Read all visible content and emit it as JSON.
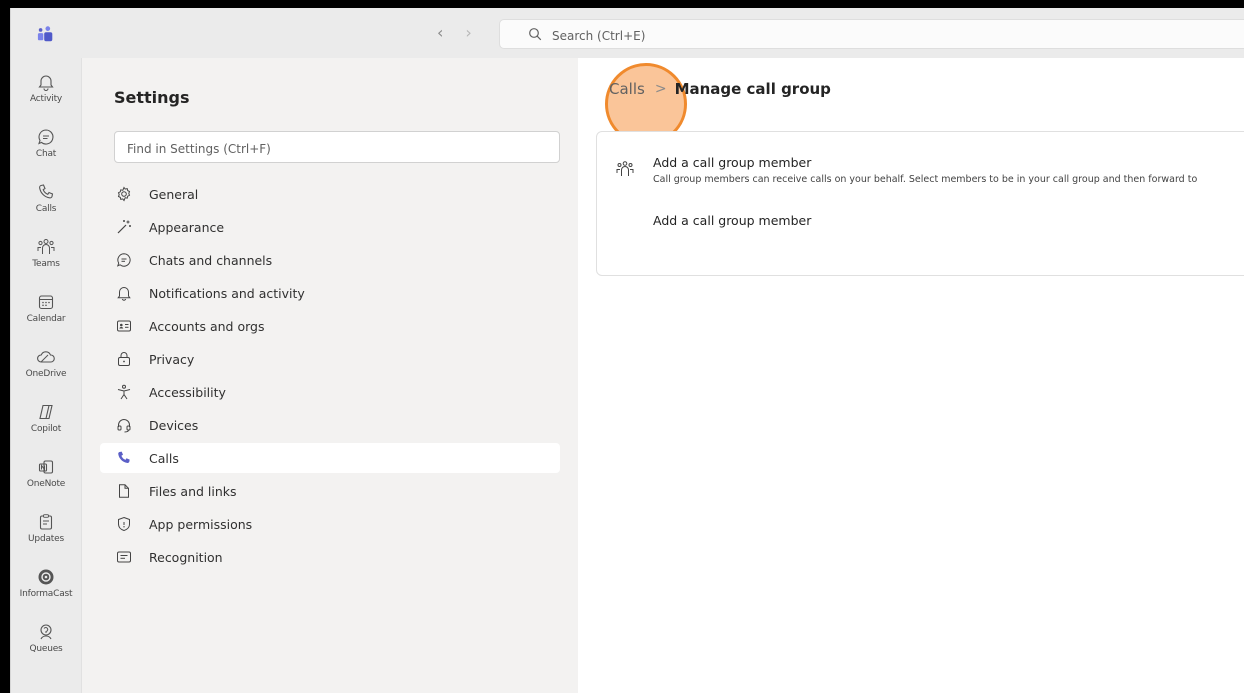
{
  "titlebar": {
    "search_placeholder": "Search (Ctrl+E)",
    "back_label": "‹",
    "forward_label": "›"
  },
  "rail": {
    "items": [
      {
        "label": "Activity",
        "icon": "bell-icon"
      },
      {
        "label": "Chat",
        "icon": "chat-icon"
      },
      {
        "label": "Calls",
        "icon": "phone-icon"
      },
      {
        "label": "Teams",
        "icon": "teams-icon"
      },
      {
        "label": "Calendar",
        "icon": "calendar-icon"
      },
      {
        "label": "OneDrive",
        "icon": "cloud-icon"
      },
      {
        "label": "Copilot",
        "icon": "copilot-icon"
      },
      {
        "label": "OneNote",
        "icon": "onenote-icon"
      },
      {
        "label": "Updates",
        "icon": "clipboard-icon"
      },
      {
        "label": "InformaCast",
        "icon": "informacast-icon"
      },
      {
        "label": "Queues",
        "icon": "queues-icon"
      }
    ]
  },
  "settings": {
    "title": "Settings",
    "find_placeholder": "Find in Settings (Ctrl+F)",
    "menu": [
      {
        "label": "General",
        "icon": "gear-icon"
      },
      {
        "label": "Appearance",
        "icon": "magic-wand-icon"
      },
      {
        "label": "Chats and channels",
        "icon": "chat-icon"
      },
      {
        "label": "Notifications and activity",
        "icon": "bell-icon"
      },
      {
        "label": "Accounts and orgs",
        "icon": "id-card-icon"
      },
      {
        "label": "Privacy",
        "icon": "lock-icon"
      },
      {
        "label": "Accessibility",
        "icon": "accessibility-icon"
      },
      {
        "label": "Devices",
        "icon": "headset-icon"
      },
      {
        "label": "Calls",
        "icon": "phone-filled-icon",
        "active": true
      },
      {
        "label": "Files and links",
        "icon": "file-icon"
      },
      {
        "label": "App permissions",
        "icon": "shield-icon"
      },
      {
        "label": "Recognition",
        "icon": "recognition-icon"
      }
    ]
  },
  "content": {
    "breadcrumb": {
      "parent": "Calls",
      "separator": ">",
      "current": "Manage call group"
    },
    "card": {
      "title": "Add a call group member",
      "description": "Call group members can receive calls on your behalf. Select members to be in your call group and then forward to",
      "action": "Add a call group member"
    }
  },
  "colors": {
    "accent": "#5b5fc7",
    "highlight": "#f08a2d"
  }
}
